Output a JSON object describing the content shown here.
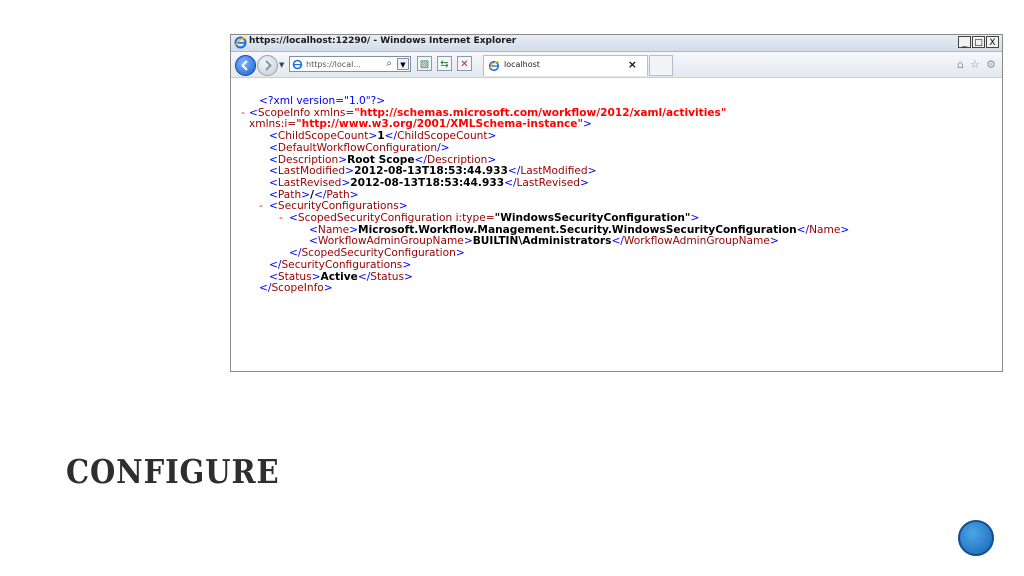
{
  "window": {
    "title": "https://localhost:12290/ - Windows Internet Explorer",
    "minimize": "_",
    "maximize": "□",
    "close": "X"
  },
  "toolbar": {
    "address_text": "https://local...",
    "tab_label": "localhost",
    "tab_close": "×"
  },
  "xml": {
    "decl": "<?xml version=\"1.0\"?>",
    "root_open_tag": "ScopeInfo",
    "root_xmlns_attr": " xmlns=",
    "root_xmlns_val": "\"http://schemas.microsoft.com/workflow/2012/xaml/activities\"",
    "root_xmlnsi_attr": "xmlns:i=",
    "root_xmlnsi_val": "\"http://www.w3.org/2001/XMLSchema-instance\"",
    "child_scope_count_tag": "ChildScopeCount",
    "child_scope_count": "1",
    "default_workflow_tag": "DefaultWorkflowConfiguration",
    "description_tag": "Description",
    "description": "Root Scope",
    "last_modified_tag": "LastModified",
    "last_modified": "2012-08-13T18:53:44.933",
    "last_revised_tag": "LastRevised",
    "last_revised": "2012-08-13T18:53:44.933",
    "path_tag": "Path",
    "path": "/",
    "security_configs_tag": "SecurityConfigurations",
    "scoped_security_tag": "ScopedSecurityConfiguration",
    "scoped_security_attr": " i:type=",
    "scoped_security_type": "\"WindowsSecurityConfiguration\"",
    "name_tag": "Name",
    "name": "Microsoft.Workflow.Management.Security.WindowsSecurityConfiguration",
    "admin_group_tag": "WorkflowAdminGroupName",
    "admin_group": "BUILTIN\\Administrators",
    "status_tag": "Status",
    "status": "Active",
    "minus": "-"
  },
  "slide": {
    "heading": "CONFIGURE"
  },
  "colors": {
    "tag": "#990000",
    "punct": "#0000ff",
    "attr_value": "#ff0000",
    "badge": "#1464b4"
  },
  "icons": [
    "ie-logo-icon",
    "back-icon",
    "forward-icon",
    "page-icon",
    "search-icon",
    "compat-view-icon",
    "refresh-icon",
    "stop-icon",
    "home-icon",
    "star-icon",
    "gear-icon"
  ]
}
